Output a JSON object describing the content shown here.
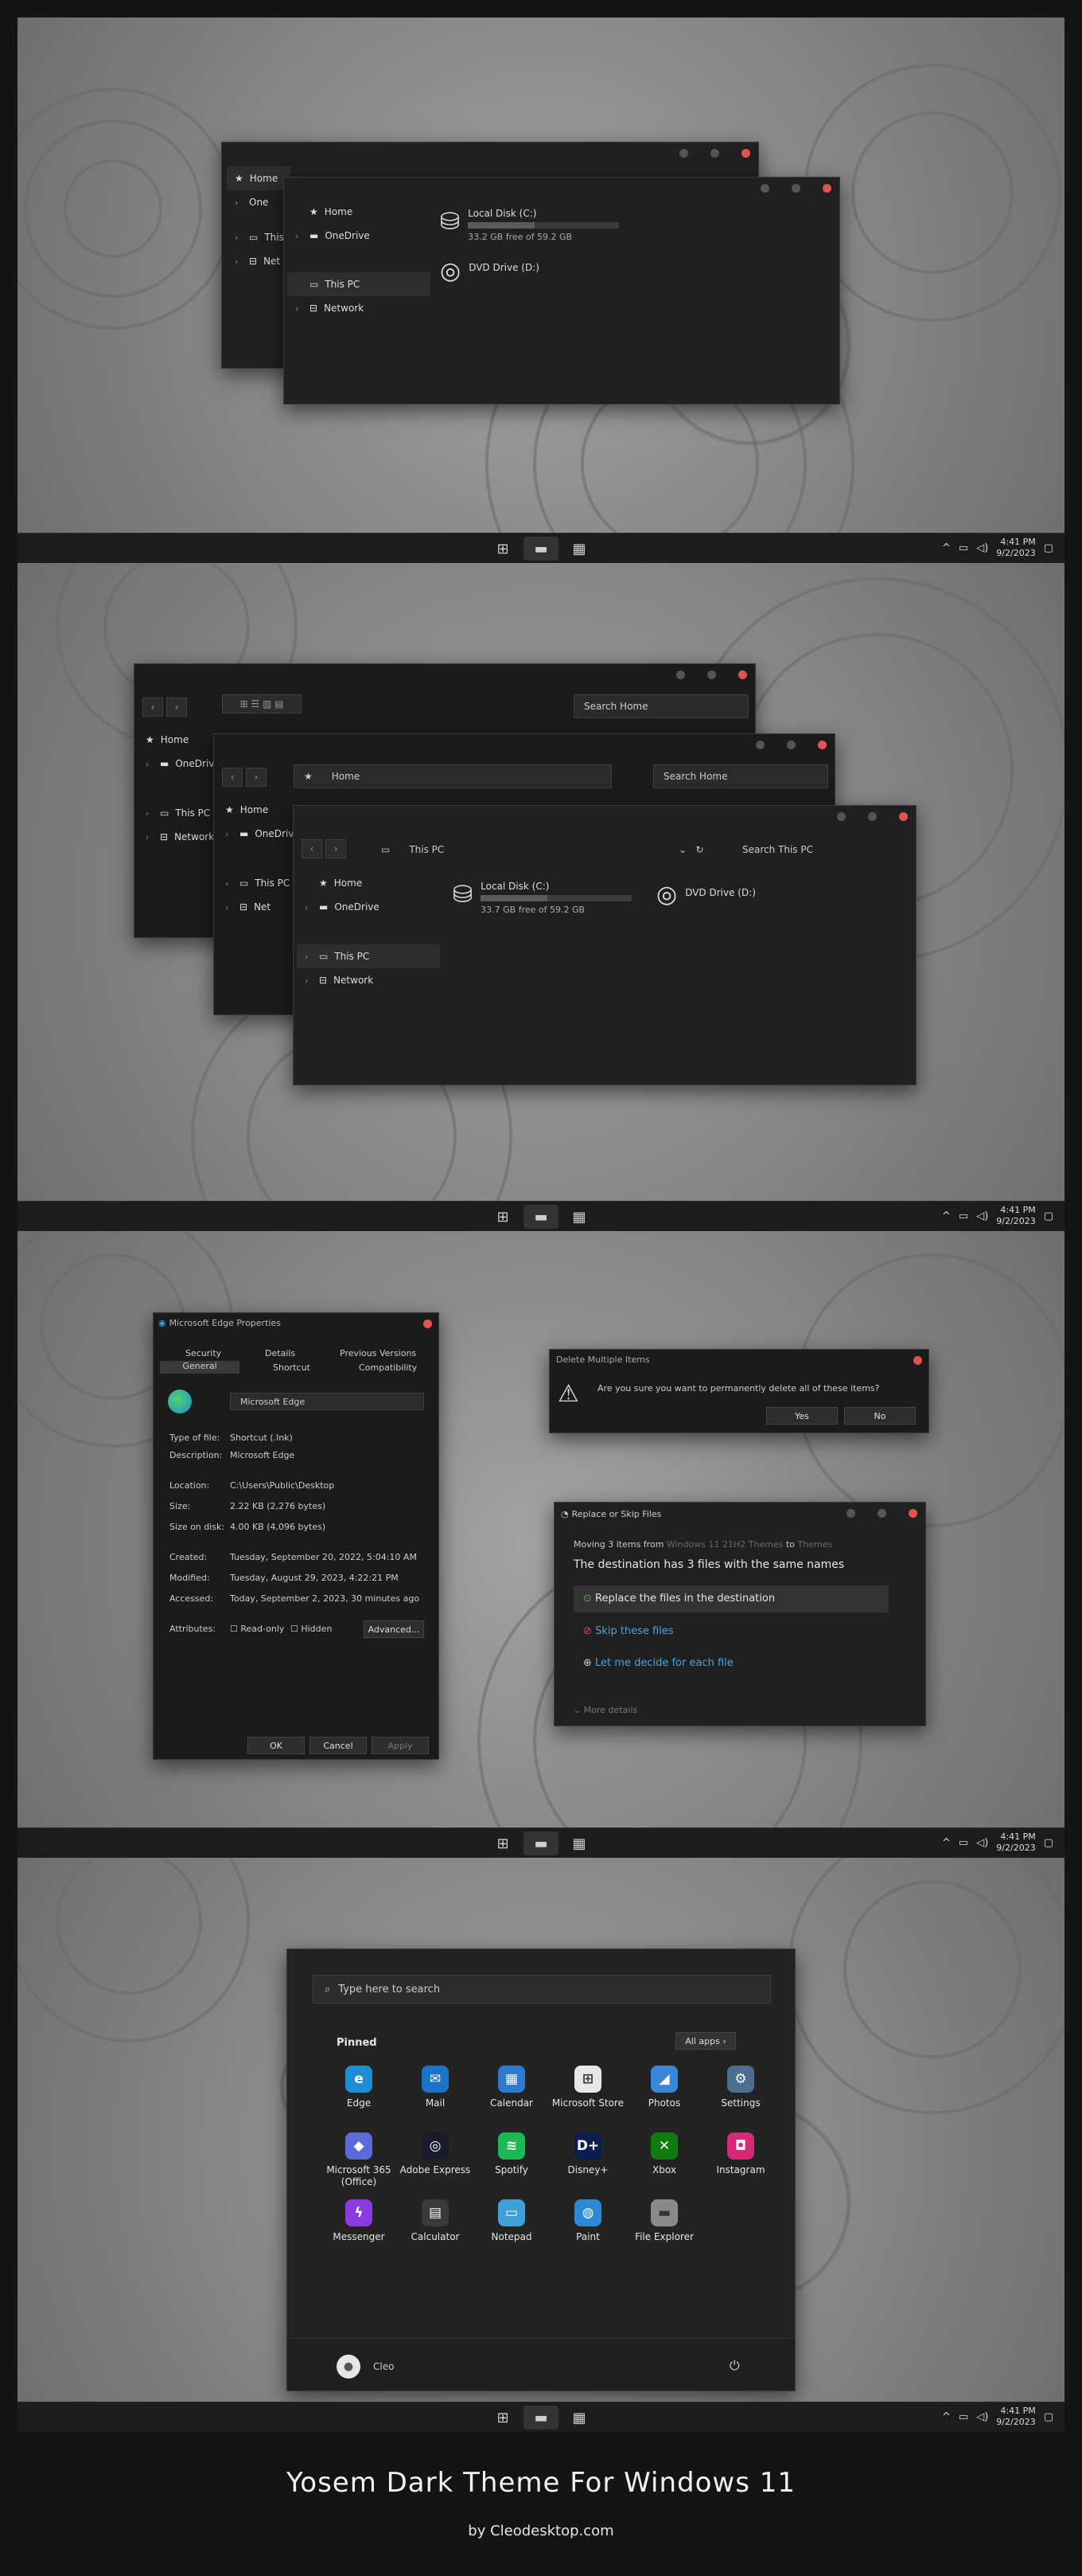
{
  "explorer": {
    "home": "Home",
    "onedrive": "OneDrive",
    "this_pc": "This PC",
    "network": "Network",
    "search_home": "Search Home",
    "search_this_pc": "Search This PC",
    "one_trunc": "One",
    "net_trunc": "Net",
    "onedrive_trunc": "OneDrive",
    "thi_trunc": "This",
    "drive_c": {
      "name": "Local Disk (C:)",
      "free1": "33.2 GB free of 59.2 GB",
      "free2": "33.7 GB free of 59.2 GB",
      "used_fraction": 0.44
    },
    "drive_d": {
      "name": "DVD Drive (D:)",
      "badge": "DVD"
    }
  },
  "taskbar": {
    "time": "4:41 PM",
    "date": "9/2/2023"
  },
  "properties": {
    "title": "Microsoft Edge Properties",
    "tabs_top": [
      "Security",
      "Details",
      "Previous Versions"
    ],
    "tabs_bottom": [
      "General",
      "Shortcut",
      "Compatibility"
    ],
    "name": "Microsoft Edge",
    "rows": [
      {
        "label": "Type of file:",
        "value": "Shortcut (.lnk)"
      },
      {
        "label": "Description:",
        "value": "Microsoft Edge"
      },
      {
        "label": "Location:",
        "value": "C:\\Users\\Public\\Desktop"
      },
      {
        "label": "Size:",
        "value": "2.22 KB (2,276 bytes)"
      },
      {
        "label": "Size on disk:",
        "value": "4.00 KB (4,096 bytes)"
      },
      {
        "label": "Created:",
        "value": "Tuesday, September 20, 2022, 5:04:10 AM"
      },
      {
        "label": "Modified:",
        "value": "Tuesday, August 29, 2023, 4:22:21 PM"
      },
      {
        "label": "Accessed:",
        "value": "Today, September 2, 2023, 30 minutes ago"
      }
    ],
    "attributes": "Attributes:",
    "read_only": "Read-only",
    "hidden": "Hidden",
    "advanced": "Advanced...",
    "ok": "OK",
    "cancel": "Cancel",
    "apply": "Apply"
  },
  "delete_dialog": {
    "title": "Delete Multiple Items",
    "message": "Are you sure you want to permanently delete all of these items?",
    "yes": "Yes",
    "no": "No"
  },
  "replace_dialog": {
    "title": "Replace or Skip Files",
    "moving_prefix": "Moving 3 items from",
    "source": "Windows 11 21H2 Themes",
    "to": "to",
    "dest": "Themes",
    "headline": "The destination has 3 files with the same names",
    "opt1": "Replace the files in the destination",
    "opt2": "Skip these files",
    "opt3": "Let me decide for each file",
    "more": "More details"
  },
  "start": {
    "search_placeholder": "Type here to search",
    "pinned": "Pinned",
    "all_apps": "All apps",
    "user": "Cleo",
    "apps": [
      {
        "name": "Edge",
        "color": "#1f8dd6",
        "glyph": "e"
      },
      {
        "name": "Mail",
        "color": "#1a73c9",
        "glyph": "✉"
      },
      {
        "name": "Calendar",
        "color": "#2d7bd1",
        "glyph": "▦"
      },
      {
        "name": "Microsoft Store",
        "color": "#e7e7e7",
        "glyph": "⊞"
      },
      {
        "name": "Photos",
        "color": "#3a86d8",
        "glyph": "◢"
      },
      {
        "name": "Settings",
        "color": "#4b6d8f",
        "glyph": "⚙"
      },
      {
        "name": "Microsoft 365 (Office)",
        "color": "#5a6ad8",
        "glyph": "◆"
      },
      {
        "name": "Adobe Express",
        "color": "#1a1a2e",
        "glyph": "◎"
      },
      {
        "name": "Spotify",
        "color": "#1db954",
        "glyph": "≋"
      },
      {
        "name": "Disney+",
        "color": "#0b1d4f",
        "glyph": "D+"
      },
      {
        "name": "Xbox",
        "color": "#107c10",
        "glyph": "✕"
      },
      {
        "name": "Instagram",
        "color": "#d6297a",
        "glyph": "◘"
      },
      {
        "name": "Messenger",
        "color": "#8a3ae0",
        "glyph": "ϟ"
      },
      {
        "name": "Calculator",
        "color": "#3a3a3a",
        "glyph": "▤"
      },
      {
        "name": "Notepad",
        "color": "#3fa0d8",
        "glyph": "▭"
      },
      {
        "name": "Paint",
        "color": "#2d89d6",
        "glyph": "◍"
      },
      {
        "name": "File Explorer",
        "color": "#8a8a8a",
        "glyph": "▬"
      }
    ]
  },
  "footer": {
    "title": "Yosem Dark Theme For Windows 11",
    "sub": "by Cleodesktop.com"
  }
}
